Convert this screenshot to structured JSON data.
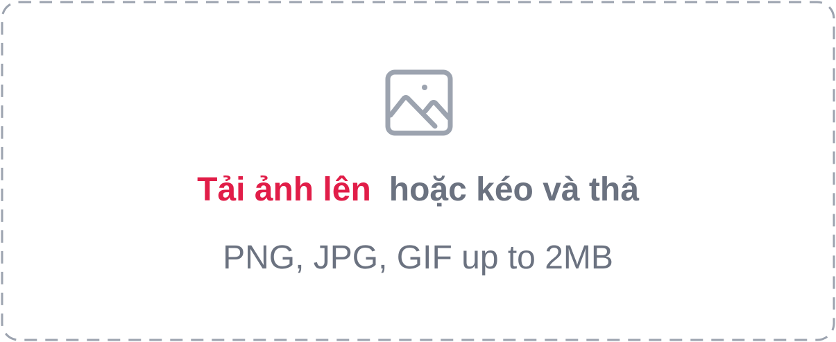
{
  "dropzone": {
    "upload_link_text": "Tải ảnh lên",
    "drag_text": "hoặc kéo và thả",
    "hint_text": "PNG, JPG, GIF up to 2MB",
    "icon": "image-icon",
    "colors": {
      "accent": "#e11d48",
      "muted_text": "#6b7280",
      "border": "#9ca3af",
      "icon": "#9ca3af"
    }
  }
}
